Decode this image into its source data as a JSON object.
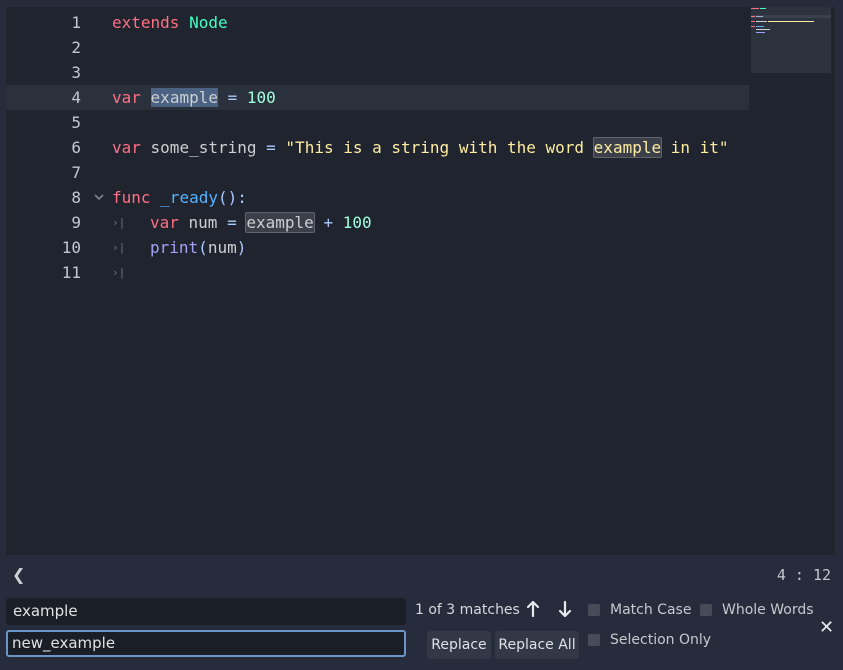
{
  "editor": {
    "lines": [
      {
        "num": "1",
        "parts": [
          [
            "kw",
            "extends"
          ],
          [
            "ident",
            " "
          ],
          [
            "type",
            "Node"
          ]
        ]
      },
      {
        "num": "2",
        "parts": []
      },
      {
        "num": "3",
        "parts": []
      },
      {
        "num": "4",
        "parts": [
          [
            "kw",
            "var"
          ],
          [
            "ident",
            " "
          ],
          [
            "sel",
            "example"
          ],
          [
            "ident",
            " "
          ],
          [
            "sym",
            "="
          ],
          [
            "ident",
            " "
          ],
          [
            "num",
            "100"
          ]
        ]
      },
      {
        "num": "5",
        "parts": []
      },
      {
        "num": "6",
        "parts": [
          [
            "kw",
            "var"
          ],
          [
            "ident",
            " some_string "
          ],
          [
            "sym",
            "="
          ],
          [
            "ident",
            " "
          ],
          [
            "str",
            "\"This is a string with the word "
          ],
          [
            "match-str",
            "example"
          ],
          [
            "str",
            " in it\""
          ]
        ]
      },
      {
        "num": "7",
        "parts": []
      },
      {
        "num": "8",
        "parts": [
          [
            "kw",
            "func"
          ],
          [
            "ident",
            " "
          ],
          [
            "fn",
            "_ready"
          ],
          [
            "sym",
            "():"
          ]
        ]
      },
      {
        "num": "9",
        "parts": [
          [
            "kw",
            "var"
          ],
          [
            "ident",
            " num "
          ],
          [
            "sym",
            "="
          ],
          [
            "ident",
            " "
          ],
          [
            "match",
            "example"
          ],
          [
            "ident",
            " "
          ],
          [
            "sym",
            "+"
          ],
          [
            "ident",
            " "
          ],
          [
            "num",
            "100"
          ]
        ]
      },
      {
        "num": "10",
        "parts": [
          [
            "builtin",
            "print"
          ],
          [
            "sym",
            "("
          ],
          [
            "ident",
            "num"
          ],
          [
            "sym",
            ")"
          ]
        ]
      },
      {
        "num": "11",
        "parts": []
      }
    ],
    "fold_icon": "chevron-down-icon",
    "tab_glyph": "›|"
  },
  "status": {
    "collapse_icon": "❮",
    "cursor_line": "4",
    "cursor_sep": " : ",
    "cursor_col": "12"
  },
  "search": {
    "find_value": "example",
    "replace_value": "new_example",
    "matches_text": "1 of 3 matches",
    "prev_icon": "🡑",
    "next_icon": "🡓",
    "match_case_label": "Match Case",
    "whole_words_label": "Whole Words",
    "selection_only_label": "Selection Only",
    "replace_label": "Replace",
    "replace_all_label": "Replace All",
    "close_icon": "✕"
  },
  "colors": {
    "keyword": "#ff7085",
    "type": "#42ffc2",
    "number": "#a1ffe0",
    "string": "#ffeda1",
    "function": "#57b3ff",
    "selection": "#4c6282",
    "replace_focus": "#6996c6"
  }
}
